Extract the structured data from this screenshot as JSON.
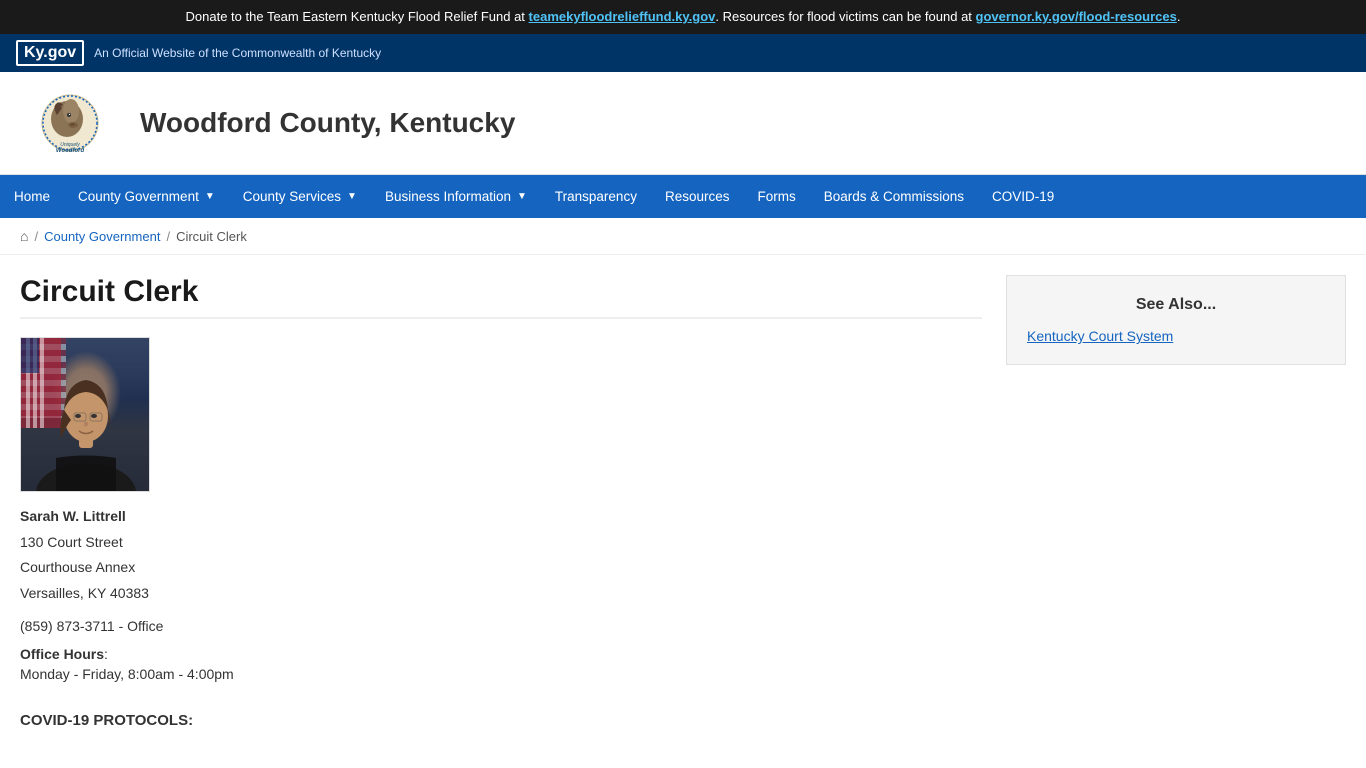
{
  "alert": {
    "text": "Donate to the Team Eastern Kentucky Flood Relief Fund at ",
    "link1_text": "teamekyfloodrelieffund.ky.gov",
    "link1_href": "https://teamekyfloodrelieffund.ky.gov",
    "mid_text": ". Resources for flood victims can be found at ",
    "link2_text": "governor.ky.gov/flood-resources",
    "link2_href": "https://governor.ky.gov/flood-resources",
    "end_text": "."
  },
  "kygov_bar": {
    "logo": "Ky.gov",
    "subtitle": "An Official Website of the Commonwealth of Kentucky"
  },
  "header": {
    "site_title": "Woodford County, Kentucky"
  },
  "nav": {
    "items": [
      {
        "label": "Home",
        "has_dropdown": false
      },
      {
        "label": "County Government",
        "has_dropdown": true
      },
      {
        "label": "County Services",
        "has_dropdown": true
      },
      {
        "label": "Business Information",
        "has_dropdown": true
      },
      {
        "label": "Transparency",
        "has_dropdown": false
      },
      {
        "label": "Resources",
        "has_dropdown": false
      },
      {
        "label": "Forms",
        "has_dropdown": false
      },
      {
        "label": "Boards & Commissions",
        "has_dropdown": false
      },
      {
        "label": "COVID-19",
        "has_dropdown": false
      }
    ]
  },
  "breadcrumb": {
    "home_symbol": "⌂",
    "separator": "/",
    "county_gov_label": "County Government",
    "current_label": "Circuit Clerk"
  },
  "page": {
    "title": "Circuit Clerk",
    "person_name": "Sarah W. Littrell",
    "address_line1": "130 Court Street",
    "address_line2": "Courthouse Annex",
    "address_line3": "Versailles, KY  40383",
    "phone": "(859) 873-3711 - Office",
    "office_hours_label": "Office Hours",
    "office_hours_colon": ":",
    "office_hours_value": "Monday - Friday, 8:00am - 4:00pm",
    "covid_title": "COVID-19 PROTOCOLS:"
  },
  "sidebar": {
    "see_also_title": "See Also...",
    "links": [
      {
        "label": "Kentucky Court System",
        "href": "#"
      }
    ]
  }
}
